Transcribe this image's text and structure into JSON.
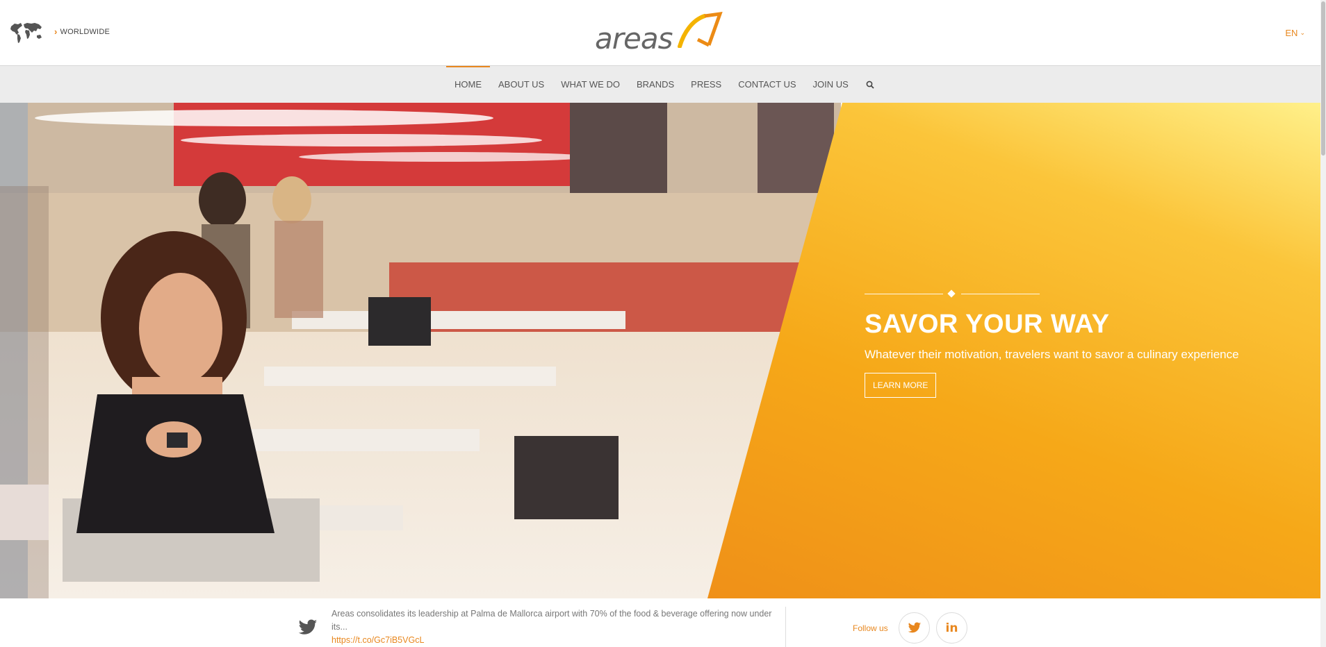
{
  "header": {
    "region_label": "WORLDWIDE",
    "logo_text": "areas",
    "language": "EN"
  },
  "nav": {
    "items": [
      {
        "label": "HOME",
        "active": true
      },
      {
        "label": "ABOUT US"
      },
      {
        "label": "WHAT WE DO"
      },
      {
        "label": "BRANDS"
      },
      {
        "label": "PRESS"
      },
      {
        "label": "CONTACT US"
      },
      {
        "label": "JOIN US"
      }
    ],
    "search_icon": "search-icon"
  },
  "hero": {
    "title": "SAVOR YOUR WAY",
    "subtitle": "Whatever their motivation, travelers want to savor a culinary experience",
    "cta_label": "LEARN MORE"
  },
  "footer": {
    "tweet_text": "Areas consolidates its leadership at Palma de Mallorca airport with 70% of the food & beverage offering now under its...",
    "tweet_link": "https://t.co/Gc7iB5VGcL",
    "follow_label": "Follow us",
    "social": [
      "twitter-icon",
      "linkedin-icon"
    ],
    "linkedin_text": "in"
  },
  "colors": {
    "accent": "#e8871e",
    "hero_orange": "#f0951a",
    "nav_bg": "#ececec"
  }
}
